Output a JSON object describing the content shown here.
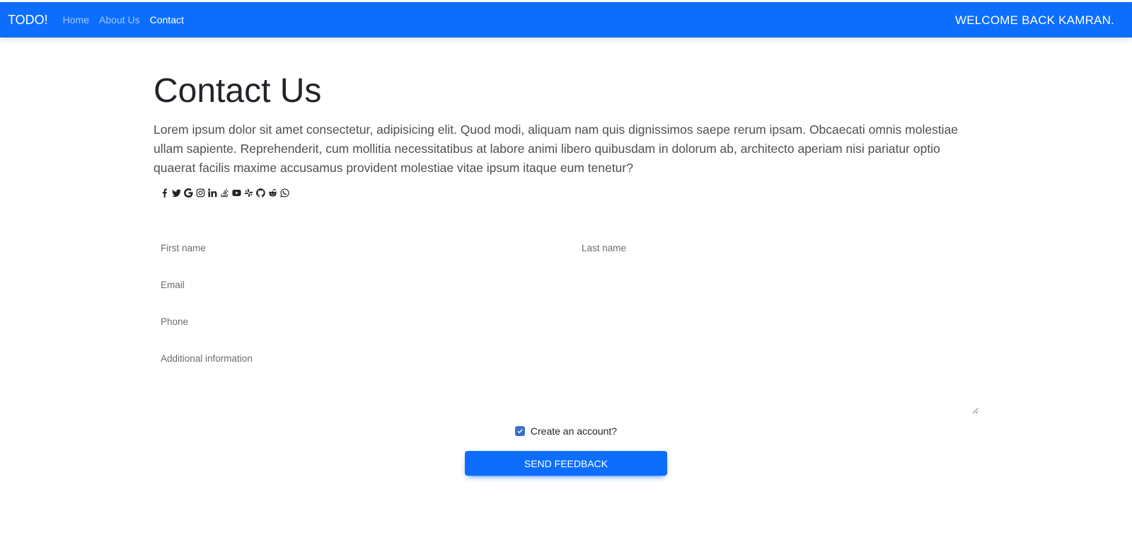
{
  "navbar": {
    "brand": "TODO!",
    "links": [
      {
        "label": "Home",
        "active": false
      },
      {
        "label": "About Us",
        "active": false
      },
      {
        "label": "Contact",
        "active": true
      }
    ],
    "welcome": "WELCOME BACK KAMRAN.",
    "color": "#0d6efd"
  },
  "main": {
    "title": "Contact Us",
    "lead": "Lorem ipsum dolor sit amet consectetur, adipisicing elit. Quod modi, aliquam nam quis dignissimos saepe rerum ipsam. Obcaecati omnis molestiae ullam sapiente. Reprehenderit, cum mollitia necessitatibus at labore animi libero quibusdam in dolorum ab, architecto aperiam nisi pariatur optio quaerat facilis maxime accusamus provident molestiae vitae ipsum itaque eum tenetur?",
    "socials": [
      "facebook-icon",
      "twitter-icon",
      "google-icon",
      "instagram-icon",
      "linkedin-icon",
      "stack-overflow-icon",
      "youtube-icon",
      "slack-icon",
      "github-icon",
      "reddit-icon",
      "whatsapp-icon"
    ]
  },
  "form": {
    "first_name": {
      "label": "First name",
      "value": ""
    },
    "last_name": {
      "label": "Last name",
      "value": ""
    },
    "email": {
      "label": "Email",
      "value": ""
    },
    "phone": {
      "label": "Phone",
      "value": ""
    },
    "additional": {
      "label": "Additional information",
      "value": ""
    },
    "create_account": {
      "label": "Create an account?",
      "checked": true
    },
    "submit_label": "SEND FEEDBACK"
  }
}
